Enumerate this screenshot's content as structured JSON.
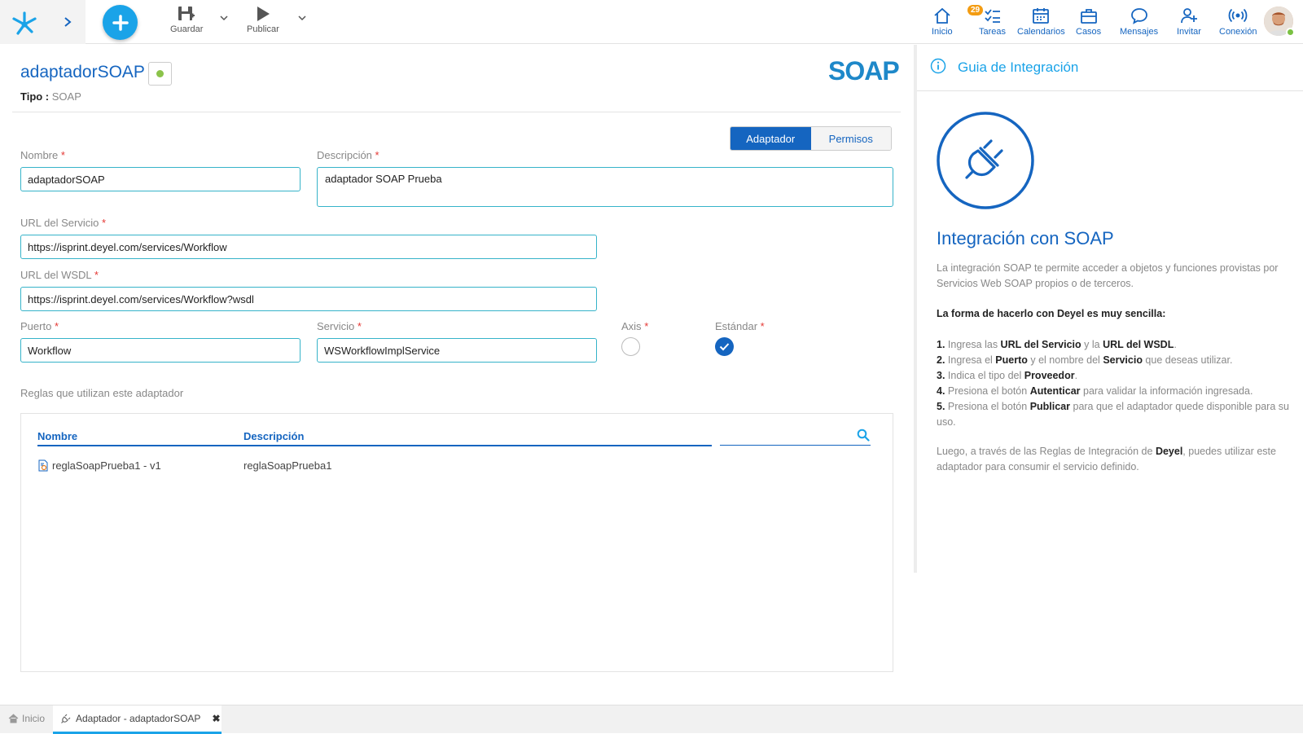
{
  "toolbar": {
    "guardar_label": "Guardar",
    "publicar_label": "Publicar"
  },
  "nav": {
    "inicio": "Inicio",
    "tareas": "Tareas",
    "tareas_badge": "29",
    "calendarios": "Calendarios",
    "casos": "Casos",
    "mensajes": "Mensajes",
    "invitar": "Invitar",
    "conexion": "Conexión"
  },
  "header": {
    "title": "adaptadorSOAP",
    "tipo_label": "Tipo :",
    "tipo_value": "SOAP",
    "logo_text": "SOAP"
  },
  "tabs": {
    "adaptador": "Adaptador",
    "permisos": "Permisos"
  },
  "form": {
    "nombre_label": "Nombre",
    "nombre_value": "adaptadorSOAP",
    "descripcion_label": "Descripción",
    "descripcion_value": "adaptador SOAP Prueba",
    "url_servicio_label": "URL del Servicio",
    "url_servicio_value": "https://isprint.deyel.com/services/Workflow",
    "url_wsdl_label": "URL del WSDL",
    "url_wsdl_value": "https://isprint.deyel.com/services/Workflow?wsdl",
    "puerto_label": "Puerto",
    "puerto_value": "Workflow",
    "servicio_label": "Servicio",
    "servicio_value": "WSWorkflowImplService",
    "axis_label": "Axis",
    "estandar_label": "Estándar",
    "required_mark": "*"
  },
  "rules": {
    "section_label": "Reglas que utilizan este adaptador",
    "col_nombre": "Nombre",
    "col_descripcion": "Descripción",
    "rows": [
      {
        "nombre": "reglaSoapPrueba1 - v1",
        "descripcion": "reglaSoapPrueba1"
      }
    ]
  },
  "guide": {
    "title": "Guia de Integración",
    "heading": "Integración con SOAP",
    "intro": "La integración SOAP te permite acceder a objetos y funciones provistas por Servicios Web SOAP propios o de terceros.",
    "bold_line": "La forma de hacerlo con Deyel es muy sencilla:",
    "s1_a": "Ingresa las ",
    "s1_b": "URL del Servicio",
    "s1_c": " y la ",
    "s1_d": "URL del WSDL",
    "s2_a": "Ingresa el ",
    "s2_b": "Puerto",
    "s2_c": " y el nombre del ",
    "s2_d": "Servicio",
    "s2_e": " que deseas utilizar.",
    "s3_a": "Indica el tipo del ",
    "s3_b": "Proveedor",
    "s4_a": "Presiona el botón ",
    "s4_b": "Autenticar",
    "s4_c": " para validar la información ingresada.",
    "s5_a": "Presiona el botón ",
    "s5_b": "Publicar",
    "s5_c": " para que el adaptador quede disponible para su uso.",
    "outro_a": "Luego, a través de las Reglas de Integración de ",
    "outro_b": "Deyel",
    "outro_c": ", puedes utilizar este adaptador para consumir el servicio definido."
  },
  "bottom": {
    "home_tab": "Inicio",
    "active_tab": "Adaptador - adaptadorSOAP",
    "close": "✖"
  },
  "colors": {
    "primary": "#1565c0",
    "accent": "#1aa3e8",
    "input_border": "#36b3c9",
    "required": "#e53935",
    "status_ok": "#8bc34a"
  }
}
